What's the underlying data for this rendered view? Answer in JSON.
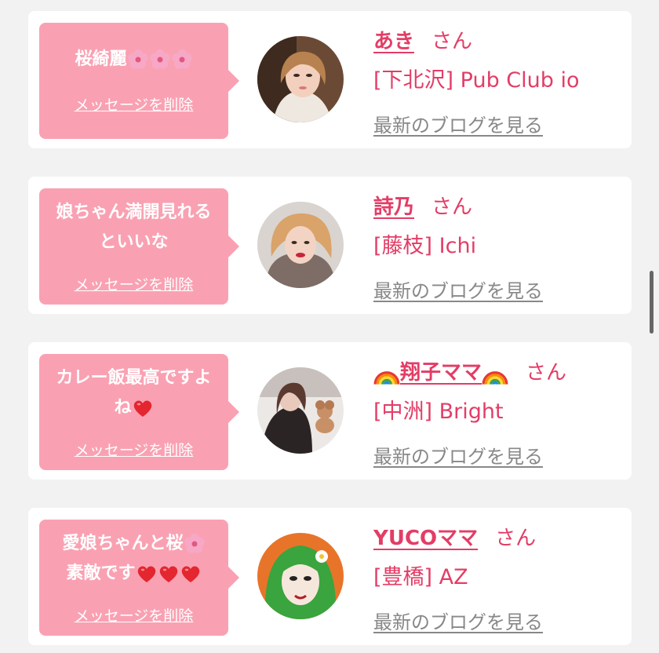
{
  "entries": [
    {
      "message": "桜綺麗",
      "delete_label": "メッセージを削除",
      "name": "あき",
      "san": "さん",
      "shop": "[下北沢] Pub Club io",
      "blog_link": "最新のブログを見る"
    },
    {
      "message": "娘ちゃん満開見れるといいな",
      "delete_label": "メッセージを削除",
      "name": "詩乃",
      "san": "さん",
      "shop": "[藤枝] Ichi",
      "blog_link": "最新のブログを見る"
    },
    {
      "message": "カレー飯最高ですよね",
      "delete_label": "メッセージを削除",
      "name": "翔子ママ",
      "san": "さん",
      "shop": "[中洲] Bright",
      "blog_link": "最新のブログを見る"
    },
    {
      "message_line1": "愛娘ちゃんと桜",
      "message_line2": "素敵です",
      "delete_label": "メッセージを削除",
      "name": "YUCOママ",
      "san": "さん",
      "shop": "[豊橋] AZ",
      "blog_link": "最新のブログを見る"
    }
  ],
  "colors": {
    "accent": "#e33d66",
    "bubble": "#f9a1b2",
    "background": "#f2f2f2"
  },
  "icons": [
    "cherry-blossom-icon",
    "heart-icon",
    "rainbow-icon"
  ]
}
